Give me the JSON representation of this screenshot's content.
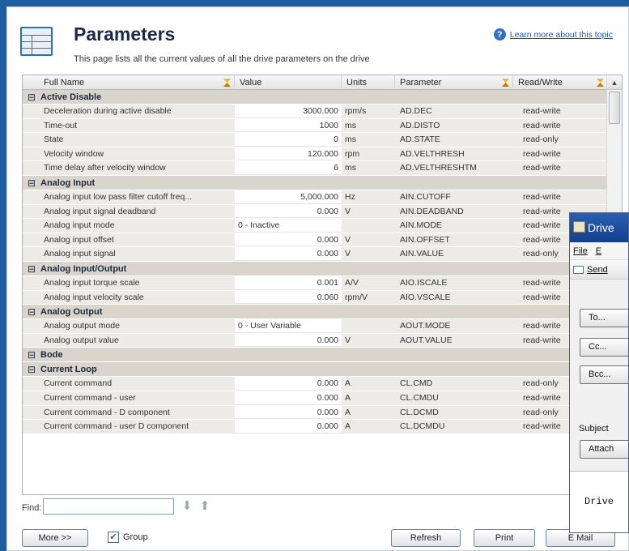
{
  "header": {
    "title": "Parameters",
    "description": "This page lists all the current values of all the drive parameters on the drive",
    "help_link": "Learn more about this topic"
  },
  "table": {
    "columns": [
      "Full Name",
      "Value",
      "Units",
      "Parameter",
      "Read/Write"
    ],
    "groups": [
      {
        "name": "Active Disable",
        "rows": [
          {
            "name": "Deceleration during active disable",
            "value": "3000.000",
            "units": "rpm/s",
            "param": "AD.DEC",
            "rw": "read-write"
          },
          {
            "name": "Time-out",
            "value": "1000",
            "units": "ms",
            "param": "AD.DISTO",
            "rw": "read-write"
          },
          {
            "name": "State",
            "value": "0",
            "units": "ms",
            "param": "AD.STATE",
            "rw": "read-only"
          },
          {
            "name": "Velocity window",
            "value": "120.000",
            "units": "rpm",
            "param": "AD.VELTHRESH",
            "rw": "read-write"
          },
          {
            "name": "Time delay after velocity window",
            "value": "6",
            "units": "ms",
            "param": "AD.VELTHRESHTM",
            "rw": "read-write"
          }
        ]
      },
      {
        "name": "Analog Input",
        "rows": [
          {
            "name": "Analog input low pass filter cutoff freq...",
            "value": "5,000.000",
            "units": "Hz",
            "param": "AIN.CUTOFF",
            "rw": "read-write"
          },
          {
            "name": "Analog input signal deadband",
            "value": "0.000",
            "units": "V",
            "param": "AIN.DEADBAND",
            "rw": "read-write"
          },
          {
            "name": "Analog input mode",
            "value": "0 - Inactive",
            "units": "",
            "param": "AIN.MODE",
            "rw": "read-write"
          },
          {
            "name": "Analog input offset",
            "value": "0.000",
            "units": "V",
            "param": "AIN.OFFSET",
            "rw": "read-write"
          },
          {
            "name": "Analog input signal",
            "value": "0.000",
            "units": "V",
            "param": "AIN.VALUE",
            "rw": "read-only"
          }
        ]
      },
      {
        "name": "Analog Input/Output",
        "rows": [
          {
            "name": "Analog input torque scale",
            "value": "0.001",
            "units": "A/V",
            "param": "AIO.ISCALE",
            "rw": "read-write"
          },
          {
            "name": "Analog input velocity scale",
            "value": "0.060",
            "units": "rpm/V",
            "param": "AIO.VSCALE",
            "rw": "read-write"
          }
        ]
      },
      {
        "name": "Analog Output",
        "rows": [
          {
            "name": "Analog output mode",
            "value": "0 - User Variable",
            "units": "",
            "param": "AOUT.MODE",
            "rw": "read-write"
          },
          {
            "name": "Analog output value",
            "value": "0.000",
            "units": "V",
            "param": "AOUT.VALUE",
            "rw": "read-write"
          }
        ]
      },
      {
        "name": "Bode",
        "rows": []
      },
      {
        "name": "Current Loop",
        "rows": [
          {
            "name": "Current command",
            "value": "0.000",
            "units": "A",
            "param": "CL.CMD",
            "rw": "read-only"
          },
          {
            "name": "Current command - user",
            "value": "0.000",
            "units": "A",
            "param": "CL.CMDU",
            "rw": "read-write"
          },
          {
            "name": "Current command - D component",
            "value": "0.000",
            "units": "A",
            "param": "CL.DCMD",
            "rw": "read-only"
          },
          {
            "name": "Current command - user D component",
            "value": "0.000",
            "units": "A",
            "param": "CL.DCMDU",
            "rw": "read-write"
          }
        ]
      }
    ]
  },
  "find": {
    "label": "Find:",
    "value": ""
  },
  "footer": {
    "more_label": "More >>",
    "group_label": "Group",
    "group_checked": true,
    "refresh_label": "Refresh",
    "print_label": "Print",
    "email_label": "E Mail"
  },
  "email_window": {
    "title": "Drive",
    "menu": [
      "File",
      "E"
    ],
    "send_label": "Send",
    "to_label": "To...",
    "cc_label": "Cc...",
    "bcc_label": "Bcc...",
    "subject_label": "Subject",
    "attach_label": "Attach",
    "body_text": "Drive"
  },
  "colors": {
    "frame_bg": "#1d5ea0",
    "group_bg": "#d9d4cc",
    "row_bg": "#edebe7",
    "title_bar": "#2b5fb3"
  }
}
